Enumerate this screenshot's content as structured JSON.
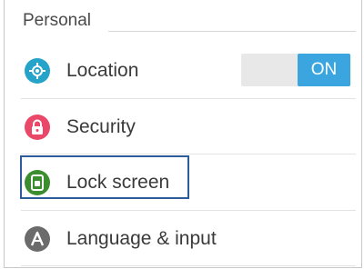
{
  "section": {
    "title": "Personal"
  },
  "items": [
    {
      "label": "Location",
      "icon": "location-icon",
      "color": "#25a3c8"
    },
    {
      "label": "Security",
      "icon": "lock-icon",
      "color": "#e94869"
    },
    {
      "label": "Lock screen",
      "icon": "lock-screen-icon",
      "color": "#3c8d2f"
    },
    {
      "label": "Language & input",
      "icon": "language-icon",
      "color": "#6b6b6b"
    }
  ],
  "location_toggle": {
    "state_label": "ON",
    "on": true,
    "accent": "#3aa5df"
  }
}
